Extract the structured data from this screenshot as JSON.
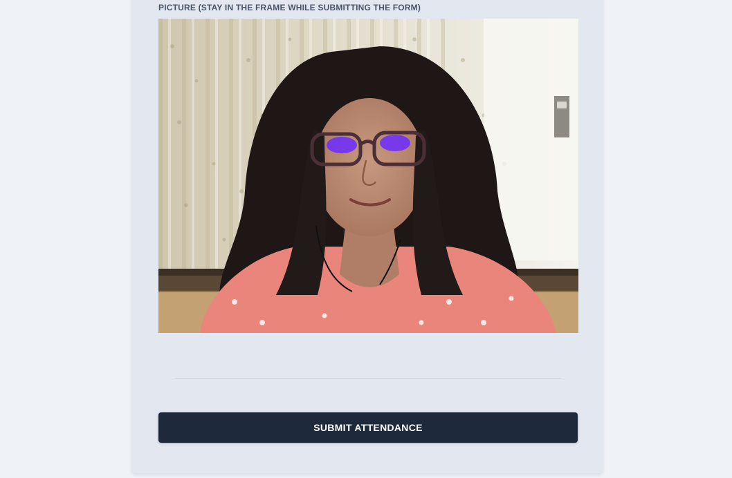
{
  "form": {
    "picture_label": "PICTURE (STAY IN THE FRAME WHILE SUBMITTING THE FORM)",
    "submit_label": "SUBMIT ATTENDANCE"
  },
  "camera": {
    "description": "webcam-preview"
  },
  "colors": {
    "page_background": "#eff3f8",
    "card_background": "#e2e7f0",
    "label_text": "#4a5568",
    "button_background": "#1e293b",
    "button_text": "#ffffff"
  }
}
